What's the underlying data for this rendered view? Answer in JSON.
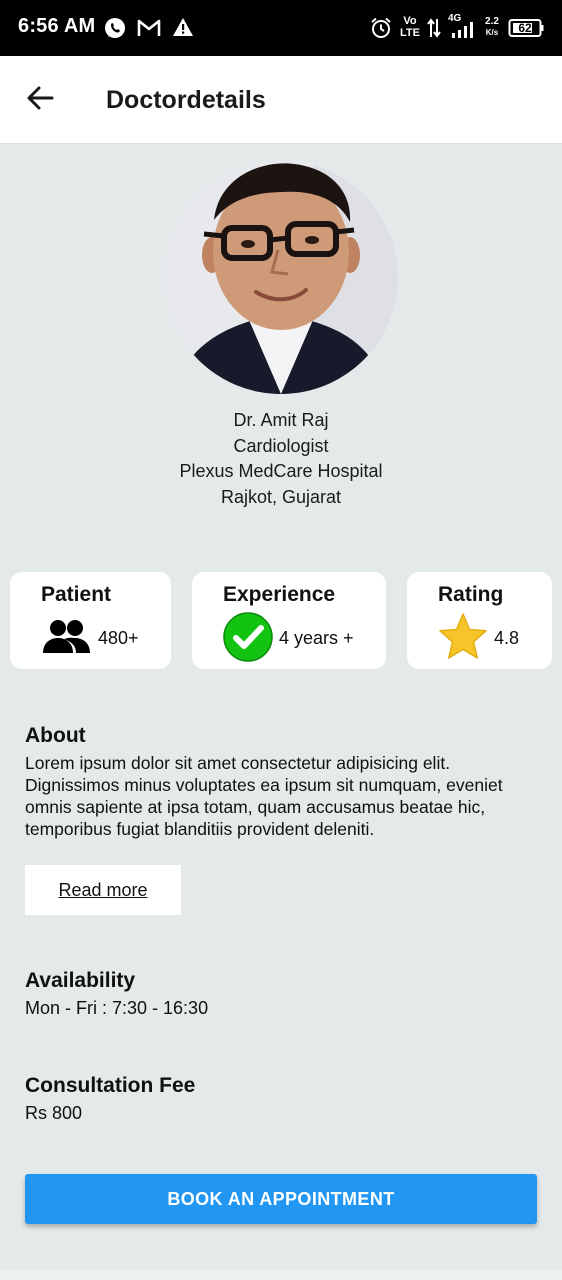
{
  "status_bar": {
    "time": "6:56 AM",
    "battery": "62",
    "net_speed_top": "2.2",
    "net_speed_bottom": "K/s",
    "network_type": "4G",
    "volte_top": "Vo",
    "volte_bottom": "LTE",
    "icons": [
      "whatsapp-icon",
      "gmail-icon",
      "warning-icon",
      "alarm-icon",
      "volte-icon",
      "data-arrows-icon",
      "signal-icon",
      "battery-icon"
    ]
  },
  "app_bar": {
    "title": "Doctordetails",
    "back_icon": "arrow-left-icon"
  },
  "doctor": {
    "name": "Dr. Amit Raj",
    "specialty": "Cardiologist",
    "hospital": "Plexus MedCare Hospital",
    "location": "Rajkot, Gujarat"
  },
  "stats": {
    "patient": {
      "title": "Patient",
      "value": "480+",
      "icon": "people-icon"
    },
    "experience": {
      "title": "Experience",
      "value": "4 years +",
      "icon": "check-circle-icon"
    },
    "rating": {
      "title": "Rating",
      "value": "4.8",
      "icon": "star-icon"
    }
  },
  "about": {
    "heading": "About",
    "text": "Lorem ipsum dolor sit amet consectetur adipisicing elit. Dignissimos minus voluptates ea ipsum sit numquam, eveniet omnis sapiente at ipsa totam, quam accusamus beatae hic, temporibus fugiat blanditiis provident deleniti.",
    "read_more": "Read more"
  },
  "availability": {
    "heading": "Availability",
    "text": "Mon - Fri : 7:30 - 16:30"
  },
  "fee": {
    "heading": "Consultation Fee",
    "text": "Rs 800"
  },
  "book_button": "BOOK AN APPOINTMENT",
  "colors": {
    "accent": "#2196f3",
    "background": "#e3eae9",
    "check_green": "#12c312",
    "star_yellow": "#f7c52b"
  }
}
